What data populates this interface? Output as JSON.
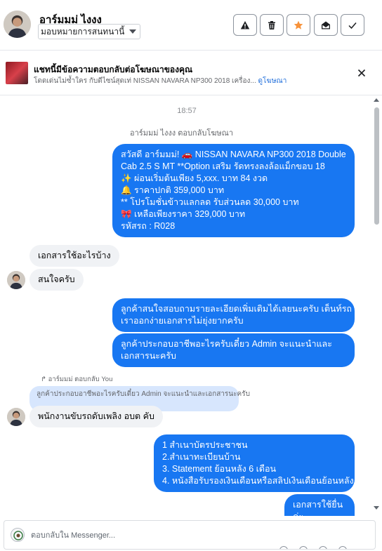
{
  "header": {
    "name": "อาร์มมม่ ไงงง",
    "assign_label": "มอบหมายการสนทนานี้",
    "buttons": [
      {
        "name": "mark-spam-button",
        "icon": "warning-icon"
      },
      {
        "name": "delete-button",
        "icon": "trash-icon"
      },
      {
        "name": "star-button",
        "icon": "star-icon",
        "color": "#f7923a"
      },
      {
        "name": "mark-unread-button",
        "icon": "envelope-open-icon"
      },
      {
        "name": "mark-done-button",
        "icon": "check-icon"
      }
    ]
  },
  "ad_banner": {
    "title": "แชทนี้มีข้อความตอบกลับต่อโฆษณาของคุณ",
    "subtitle": "โดดเด่นไม่ซ้ำใคร กับดีไซน์สุดเท่ NISSAN NAVARA NP300 2018 เครื่อง...",
    "link": "ดูโฆษณา"
  },
  "chat": {
    "timestamp": "18:57",
    "ad_reply_label": "อาร์มมม่ ไงงง ตอบกลับโฆษณา",
    "ad_message": [
      "สวัสดี อาร์มมม่! 🚗  NISSAN NAVARA NP300 2018 Double",
      "Cab 2.5 S MT **Option เสริม รัดทรงลงล้อแม็กขอบ 18",
      "✨  ผ่อนเริ่มต้นเพียง 5,xxx. บาท 84 งวด",
      "🔔 ราคาปกติ 359,000 บาท",
      "** โปรโมชั่นข้าวแลกลด รับส่วนลด 30,000 บาท",
      "🎀  เหลือเพียงราคา 329,000 บาท",
      " รหัสรถ : R028"
    ],
    "incoming_1": "เอกสารใช้อะไรบ้าง",
    "incoming_2": "สนใจครับ",
    "outgoing_1": [
      "ลูกค้าสนใจสอบถามรายละเอียดเพิ่มเติมได้เลยนะครับ เต็นท์รถ",
      "เราออกง่ายเอกสารไม่ยุ่งยากครับ"
    ],
    "outgoing_2": [
      "ลูกค้าประกอบอาชีพอะไรครับเดี๋ยว Admin จะแนะนำและ",
      "เอกสารนะครับ"
    ],
    "reply_label": "อาร์มมม่ ตอบกลับ You",
    "quoted": "ลูกค้าประกอบอาชีพอะไรครับเดี๋ยว Admin จะแนะนำและเอกสารนะครับ",
    "incoming_3": "พนักงานขับรถดับเพลิง อบต คับ",
    "outgoing_3": [
      "1 สำเนาบัตรประชาชน",
      "2.สำเนาทะเบียนบ้าน",
      "  3. Statement ย้อนหลัง 6 เดือน",
      "4. หนังสือรับรองเงินเดือนหรือสลิปเงินเดือนย้อนหลัง"
    ],
    "outgoing_4": "เอกสารใช้ยื่นค่ะ"
  },
  "composer": {
    "placeholder": "ตอบกลับใน Messenger..."
  },
  "colors": {
    "outgoing_bubble": "#1877f2",
    "incoming_bubble": "#f0f2f5",
    "quote_bubble": "#d7e6fd",
    "link": "#216fdb",
    "star": "#f7923a"
  }
}
